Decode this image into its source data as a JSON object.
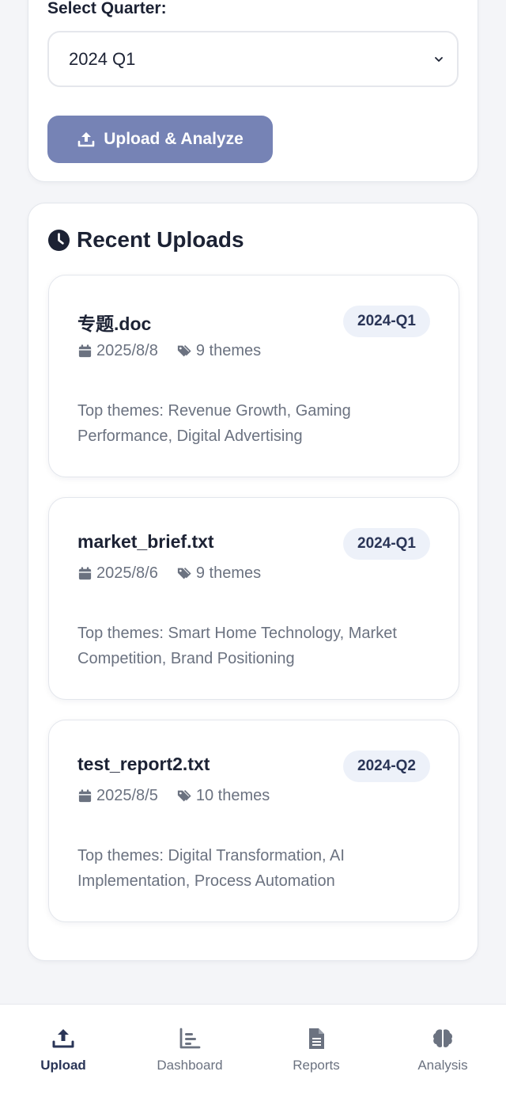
{
  "form": {
    "quarter_label": "Select Quarter:",
    "quarter_value": "2024 Q1",
    "upload_button": "Upload & Analyze"
  },
  "recent": {
    "title": "Recent Uploads",
    "items": [
      {
        "name": "专题.doc",
        "quarter": "2024-Q1",
        "date": "2025/8/8",
        "themes_count": "9 themes",
        "themes": "Top themes: Revenue Growth, Gaming Performance, Digital Advertising"
      },
      {
        "name": "market_brief.txt",
        "quarter": "2024-Q1",
        "date": "2025/8/6",
        "themes_count": "9 themes",
        "themes": "Top themes: Smart Home Technology, Market Competition, Brand Positioning"
      },
      {
        "name": "test_report2.txt",
        "quarter": "2024-Q2",
        "date": "2025/8/5",
        "themes_count": "10 themes",
        "themes": "Top themes: Digital Transformation, AI Implementation, Process Automation"
      }
    ]
  },
  "nav": {
    "items": [
      {
        "label": "Upload",
        "icon": "upload-icon",
        "active": true
      },
      {
        "label": "Dashboard",
        "icon": "chart-icon",
        "active": false
      },
      {
        "label": "Reports",
        "icon": "document-icon",
        "active": false
      },
      {
        "label": "Analysis",
        "icon": "brain-icon",
        "active": false
      }
    ]
  },
  "colors": {
    "accent": "#7683b5",
    "text_dark": "#1c2234",
    "text_muted": "#6b7280",
    "badge_bg": "#edf1f9"
  }
}
